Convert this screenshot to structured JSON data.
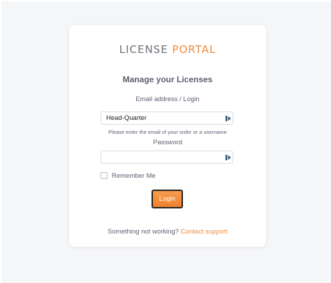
{
  "logo": {
    "part1": "LICENSE",
    "part2": "PORTAL"
  },
  "heading": "Manage your Licenses",
  "email": {
    "label": "Email address / Login",
    "value": "Head-Quarter",
    "hint": "Please enter the email of your order or a username",
    "icon": "key-icon"
  },
  "password": {
    "label": "Password",
    "value": "",
    "icon": "key-icon"
  },
  "remember_me": {
    "label": "Remember Me",
    "checked": false
  },
  "login_button": {
    "label": "Login"
  },
  "footer": {
    "text": "Something not working?",
    "link": "Contact support"
  },
  "colors": {
    "accent": "#f08a3a",
    "text": "#5a6070",
    "background": "#f5f6f8"
  }
}
